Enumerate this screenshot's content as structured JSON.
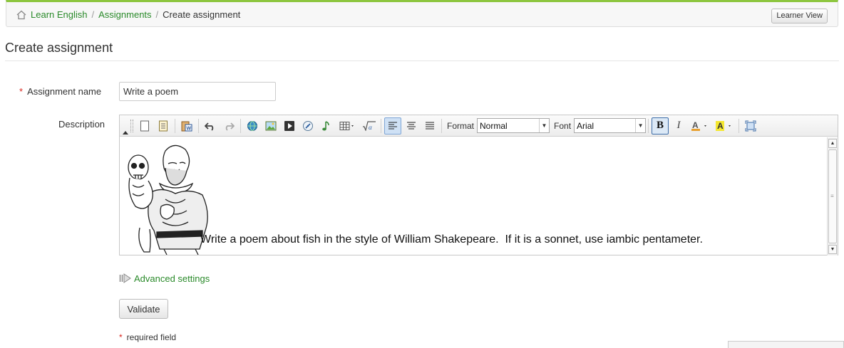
{
  "breadcrumb": {
    "items": [
      "Learn English",
      "Assignments"
    ],
    "current": "Create assignment"
  },
  "header": {
    "learner_view_label": "Learner View"
  },
  "page": {
    "title": "Create assignment"
  },
  "form": {
    "name_label": "Assignment name",
    "name_value": "Write a poem",
    "description_label": "Description",
    "required_star": "*"
  },
  "toolbar": {
    "format_label": "Format",
    "format_value": "Normal",
    "font_label": "Font",
    "font_value": "Arial",
    "bold_label": "B",
    "italic_label": "I",
    "buttons": [
      "new-page",
      "templates",
      "paste-from-word",
      "undo",
      "redo",
      "flash",
      "image",
      "video",
      "link",
      "audio",
      "table",
      "math",
      "align-left",
      "align-center",
      "justify",
      "bold",
      "italic",
      "text-color",
      "background-color",
      "maximize"
    ]
  },
  "editor": {
    "content_text": "Write a poem about fish in the style of William Shakepeare.  If it is a sonnet, use iambic pentameter."
  },
  "advanced_settings_label": "Advanced settings",
  "validate_label": "Validate",
  "required_note": "required field",
  "colors": {
    "accent_green": "#2a8a2a",
    "top_border": "#8dc63f",
    "required_red": "#d9251d"
  }
}
